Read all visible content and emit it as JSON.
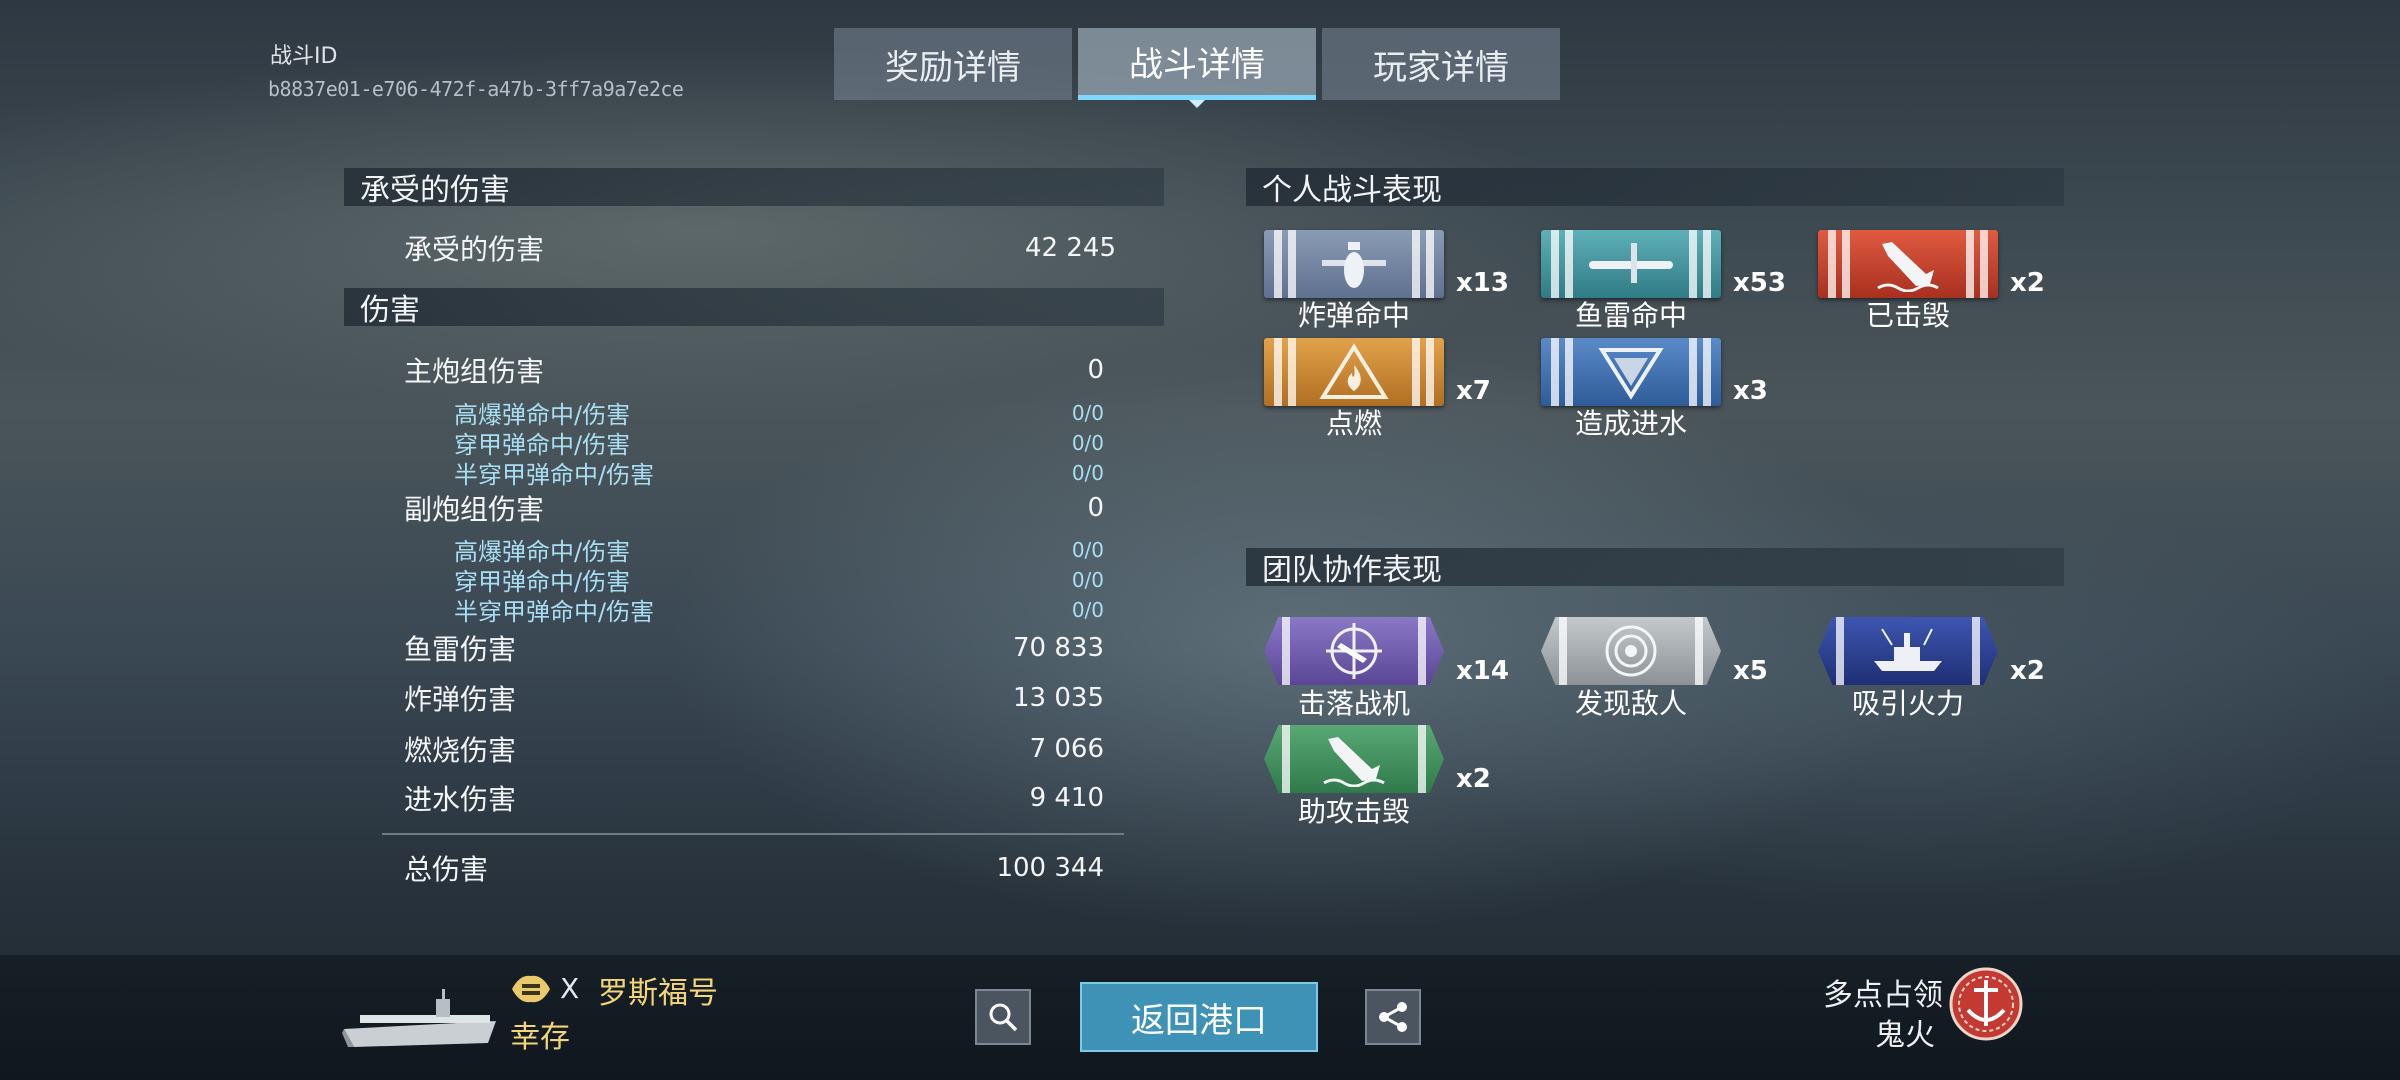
{
  "header": {
    "battle_id_label": "战斗ID",
    "battle_id_value": "b8837e01-e706-472f-a47b-3ff7a9a7e2ce",
    "tabs": [
      {
        "label": "奖励详情",
        "active": false
      },
      {
        "label": "战斗详情",
        "active": true
      },
      {
        "label": "玩家详情",
        "active": false
      }
    ]
  },
  "damage_received": {
    "title": "承受的伤害",
    "rows": [
      {
        "label": "承受的伤害",
        "value": "42 245"
      }
    ]
  },
  "damage": {
    "title": "伤害",
    "main_battery": {
      "label": "主炮组伤害",
      "value": "0",
      "sub": [
        {
          "label": "高爆弹命中/伤害",
          "value": "0/0"
        },
        {
          "label": "穿甲弹命中/伤害",
          "value": "0/0"
        },
        {
          "label": "半穿甲弹命中/伤害",
          "value": "0/0"
        }
      ]
    },
    "secondary_battery": {
      "label": "副炮组伤害",
      "value": "0",
      "sub": [
        {
          "label": "高爆弹命中/伤害",
          "value": "0/0"
        },
        {
          "label": "穿甲弹命中/伤害",
          "value": "0/0"
        },
        {
          "label": "半穿甲弹命中/伤害",
          "value": "0/0"
        }
      ]
    },
    "torpedo": {
      "label": "鱼雷伤害",
      "value": "70 833"
    },
    "bomb": {
      "label": "炸弹伤害",
      "value": "13 035"
    },
    "fire": {
      "label": "燃烧伤害",
      "value": "7 066"
    },
    "flooding": {
      "label": "进水伤害",
      "value": "9 410"
    },
    "total": {
      "label": "总伤害",
      "value": "100 344"
    }
  },
  "personal": {
    "title": "个人战斗表现",
    "ribbons": [
      {
        "name": "炸弹命中",
        "count": "x13",
        "color": "#6d7f9a",
        "icon": "bomb-icon"
      },
      {
        "name": "鱼雷命中",
        "count": "x53",
        "color": "#3f8f98",
        "icon": "torpedo-icon"
      },
      {
        "name": "已击毁",
        "count": "x2",
        "color": "#c0402c",
        "icon": "sinking-ship-icon"
      },
      {
        "name": "点燃",
        "count": "x7",
        "color": "#c7842c",
        "icon": "fire-icon"
      },
      {
        "name": "造成进水",
        "count": "x3",
        "color": "#3f6ea8",
        "icon": "flooding-icon"
      }
    ]
  },
  "team": {
    "title": "团队协作表现",
    "ribbons": [
      {
        "name": "击落战机",
        "count": "x14",
        "color": "#6a58a8",
        "icon": "plane-shot-down-icon"
      },
      {
        "name": "发现敌人",
        "count": "x5",
        "color": "#9ea4a8",
        "icon": "spotting-icon"
      },
      {
        "name": "吸引火力",
        "count": "x2",
        "color": "#2c3f8c",
        "icon": "tanking-ship-icon"
      },
      {
        "name": "助攻击毁",
        "count": "x2",
        "color": "#3f8a5a",
        "icon": "assist-destroy-icon"
      }
    ]
  },
  "footer": {
    "ship_tier": "X",
    "ship_name": "罗斯福号",
    "status": "幸存",
    "return_button": "返回港口",
    "mode": "多点占领",
    "map": "鬼火"
  },
  "colors": {
    "accent": "#7fd8ff",
    "sub_text": "#a9ddf2",
    "return_button": "#3e92b5",
    "ship_name": "#f2d479"
  }
}
